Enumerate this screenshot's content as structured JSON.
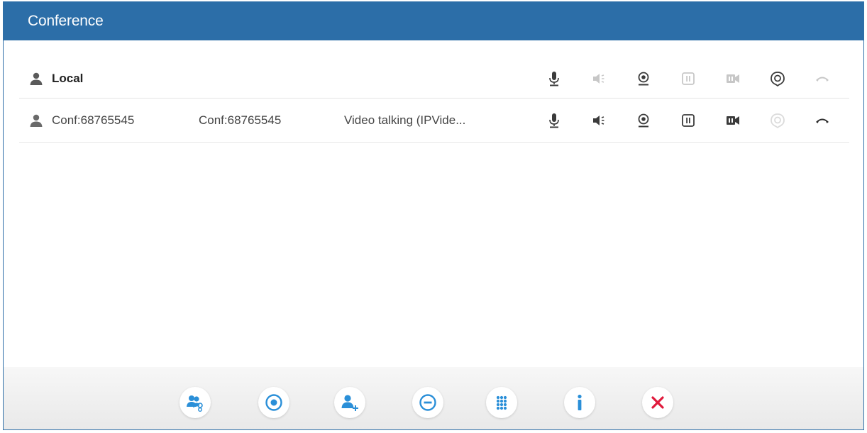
{
  "window": {
    "title": "Conference"
  },
  "participants": [
    {
      "name": "Local",
      "number": "",
      "status": "",
      "controls": [
        {
          "icon": "mic-icon",
          "state": "active"
        },
        {
          "icon": "speaker-icon",
          "state": "disabled"
        },
        {
          "icon": "webcam-icon",
          "state": "active"
        },
        {
          "icon": "hold-icon",
          "state": "disabled"
        },
        {
          "icon": "video-camera-icon",
          "state": "disabled"
        },
        {
          "icon": "record-icon",
          "state": "active"
        },
        {
          "icon": "hangup-icon",
          "state": "disabled"
        }
      ]
    },
    {
      "name": "Conf:68765545",
      "number": "Conf:68765545",
      "status": "Video talking (IPVide...",
      "controls": [
        {
          "icon": "mic-icon",
          "state": "active"
        },
        {
          "icon": "speaker-icon",
          "state": "active"
        },
        {
          "icon": "webcam-icon",
          "state": "active"
        },
        {
          "icon": "hold-icon",
          "state": "active"
        },
        {
          "icon": "video-camera-icon",
          "state": "active"
        },
        {
          "icon": "record-icon",
          "state": "disabled"
        },
        {
          "icon": "hangup-icon",
          "state": "active"
        }
      ]
    }
  ],
  "toolbar": {
    "buttons": [
      {
        "icon": "conference-users-icon"
      },
      {
        "icon": "record-circle-icon"
      },
      {
        "icon": "add-participant-icon"
      },
      {
        "icon": "remove-participant-icon"
      },
      {
        "icon": "dialpad-icon"
      },
      {
        "icon": "info-icon"
      },
      {
        "icon": "close-icon"
      }
    ]
  },
  "colors": {
    "titlebar": "#2c6ea8",
    "icon_dark": "#3b3b3b",
    "toolbar_blue": "#2a8fd8",
    "close_red": "#e01a3c"
  }
}
